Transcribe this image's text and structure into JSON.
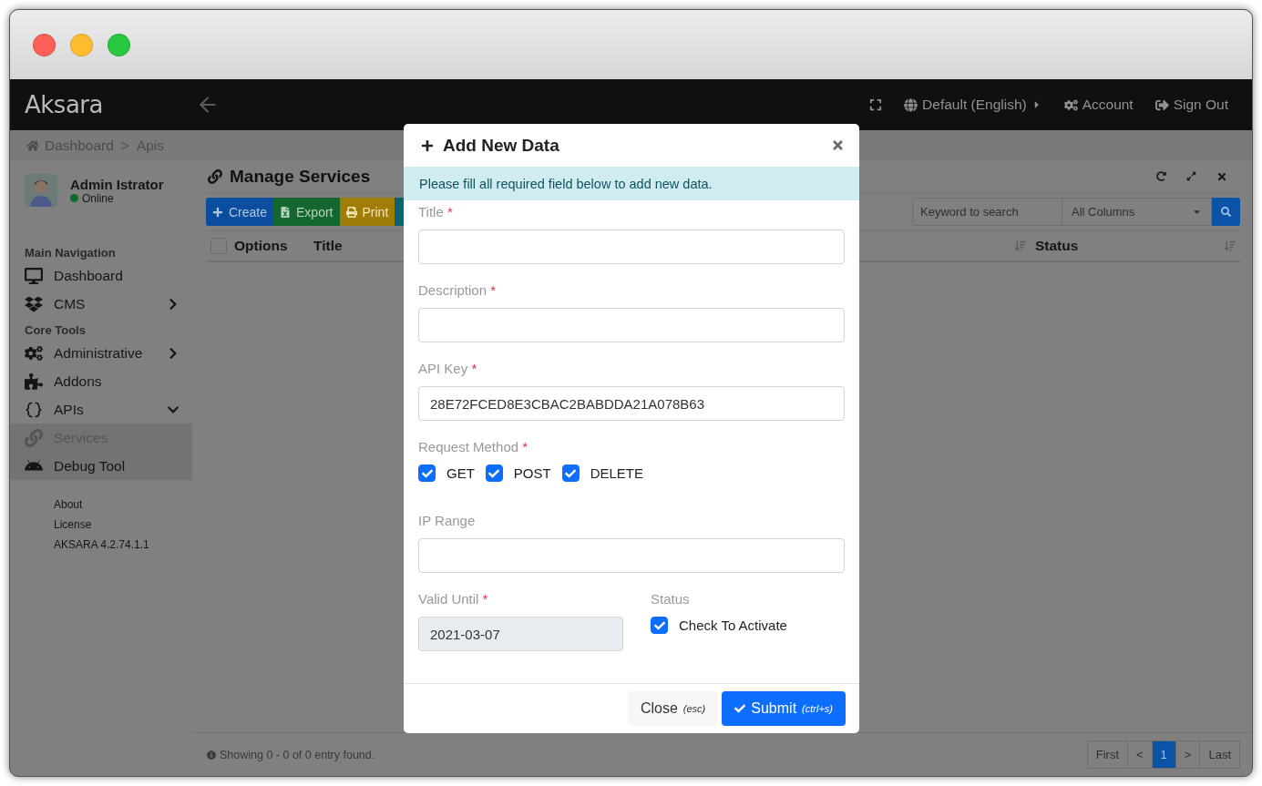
{
  "navbar": {
    "brand": "Aksara",
    "language": "Default (English)",
    "account": "Account",
    "sign_out": "Sign Out"
  },
  "breadcrumb": {
    "separator": ">",
    "items": [
      "Dashboard",
      "Apis"
    ]
  },
  "user": {
    "name": "Admin Istrator",
    "status": "Online"
  },
  "sidebar": {
    "sections": [
      {
        "heading": "Main Navigation",
        "items": [
          {
            "label": "Dashboard",
            "selected": false
          },
          {
            "label": "CMS",
            "selected": false,
            "expanded": false
          }
        ]
      },
      {
        "heading": "Core Tools",
        "items": [
          {
            "label": "Administrative",
            "selected": false,
            "expanded": false
          },
          {
            "label": "Addons",
            "selected": false
          },
          {
            "label": "APIs",
            "selected": false,
            "expanded": true,
            "children": [
              {
                "label": "Services",
                "selected": true
              },
              {
                "label": "Debug Tool",
                "selected": false
              }
            ]
          }
        ]
      }
    ],
    "footer_links": [
      "About",
      "License",
      "AKSARA 4.2.74.1.1"
    ]
  },
  "panel": {
    "title": "Manage Services",
    "toolbar": [
      {
        "kind": "create",
        "label": "Create"
      },
      {
        "kind": "export",
        "label": "Export"
      },
      {
        "kind": "print",
        "label": "Print"
      },
      {
        "kind": "other"
      }
    ],
    "search": {
      "placeholder": "Keyword to search",
      "column": "All Columns"
    },
    "columns": [
      {
        "label": "Options",
        "kind": "select",
        "checked": false
      },
      {
        "label": "Title",
        "kind": "sort"
      },
      {
        "label": "Status",
        "kind": "sort"
      }
    ],
    "status": "Showing 0 - 0 of 0 entry found.",
    "pagination": [
      {
        "label": "First",
        "selected": false
      },
      {
        "label": "<",
        "selected": false
      },
      {
        "label": "1",
        "selected": true
      },
      {
        "label": ">",
        "selected": false
      },
      {
        "label": "Last",
        "selected": false
      }
    ]
  },
  "modal": {
    "title": "Add New Data",
    "alert": "Please fill all required field below to add new data.",
    "required_mark": "*",
    "fields": [
      {
        "kind": "text",
        "label": "Title",
        "required": true
      },
      {
        "kind": "text",
        "label": "Description",
        "required": true
      },
      {
        "kind": "text",
        "label": "API Key",
        "required": true,
        "value": "28E72FCED8E3CBAC2BABDDA21A078B63"
      },
      {
        "kind": "checkboxes",
        "label": "Request Method",
        "required": true,
        "options": [
          {
            "label": "GET",
            "checked": true
          },
          {
            "label": "POST",
            "checked": true
          },
          {
            "label": "DELETE",
            "checked": true
          }
        ]
      },
      {
        "kind": "text",
        "label": "IP Range",
        "required": false
      },
      {
        "kind": "row",
        "children": [
          {
            "kind": "text",
            "label": "Valid Until",
            "required": true,
            "value": "2021-03-07",
            "disabled": true
          },
          {
            "kind": "checkboxes",
            "label": "Status",
            "required": false,
            "options": [
              {
                "label": "Check To Activate",
                "checked": true
              }
            ]
          }
        ]
      }
    ],
    "buttons": [
      {
        "kind": "close",
        "label": "Close",
        "shortcut": "(esc)"
      },
      {
        "kind": "submit",
        "label": "Submit",
        "shortcut": "(ctrl+s)"
      }
    ]
  }
}
